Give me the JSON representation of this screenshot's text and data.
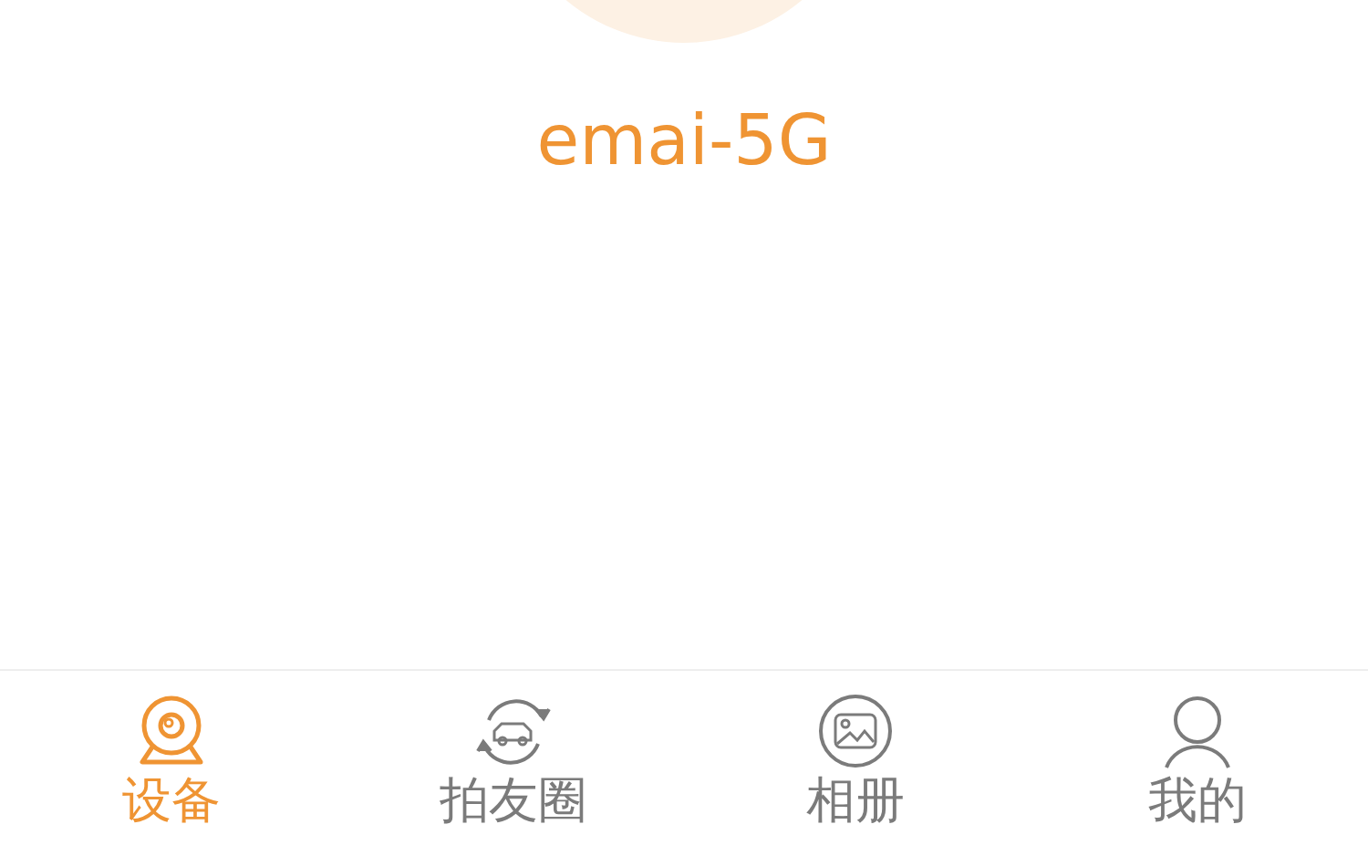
{
  "device": {
    "name": "emai-5G"
  },
  "tabs": [
    {
      "label": "设备",
      "kind": "camera",
      "selected": true
    },
    {
      "label": "拍友圈",
      "kind": "moments",
      "selected": false
    },
    {
      "label": "相册",
      "kind": "album",
      "selected": false
    },
    {
      "label": "我的",
      "kind": "profile",
      "selected": false
    }
  ]
}
